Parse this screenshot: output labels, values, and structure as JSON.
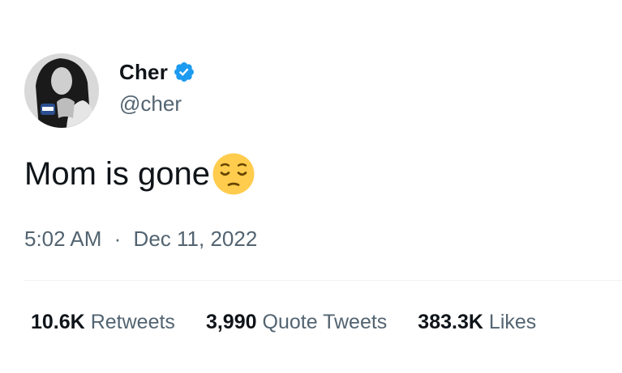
{
  "author": {
    "display_name": "Cher",
    "handle": "@cher",
    "verified": true,
    "verified_color": "#1d9bf0",
    "avatar_icon": "profile-photo"
  },
  "tweet": {
    "text": "Mom is gone",
    "emoji_icon": "pensive-face-emoji",
    "time": "5:02 AM",
    "separator": "·",
    "date": "Dec 11, 2022"
  },
  "stats": {
    "retweets": {
      "count": "10.6K",
      "label": "Retweets"
    },
    "quote_tweets": {
      "count": "3,990",
      "label": "Quote Tweets"
    },
    "likes": {
      "count": "383.3K",
      "label": "Likes"
    }
  },
  "colors": {
    "text_primary": "#0f1419",
    "text_secondary": "#536471",
    "divider": "#eff3f4",
    "emoji_yellow": "#ffcc4d"
  }
}
